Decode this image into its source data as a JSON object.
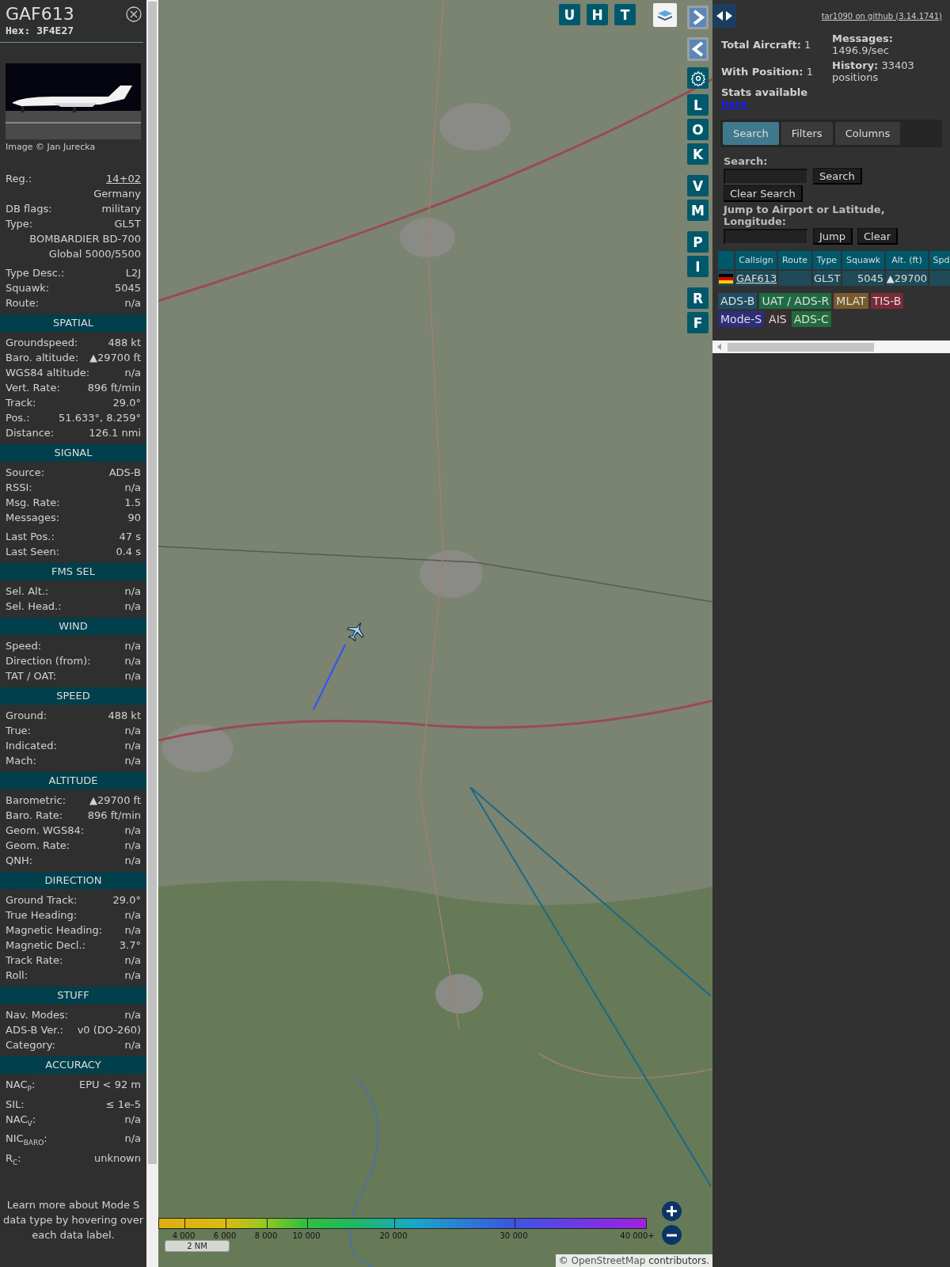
{
  "details": {
    "callsign": "GAF613",
    "hex": "Hex: 3F4E27",
    "photo_credit": "Image © Jan Jurecka",
    "registration": {
      "label": "Reg.:",
      "value": "14+02"
    },
    "groups": [
      [
        {
          "value": "Germany"
        },
        {
          "label": "DB flags:",
          "value": "military"
        },
        {
          "label": "Type:",
          "value": "GL5T"
        },
        {
          "value": "BOMBARDIER BD-700\nGlobal 5000/5500"
        }
      ],
      [
        {
          "label": "Type Desc.:",
          "value": "L2J"
        },
        {
          "label": "Squawk:",
          "value": "5045"
        },
        {
          "label": "Route:",
          "value": "n/a"
        }
      ]
    ],
    "sections": [
      {
        "title": "SPATIAL",
        "groups": [
          [
            {
              "label": "Groundspeed:",
              "value": "488 kt"
            },
            {
              "label": "Baro. altitude:",
              "value": "▲29700 ft"
            },
            {
              "label": "WGS84 altitude:",
              "value": "n/a"
            },
            {
              "label": "Vert. Rate:",
              "value": "896 ft/min"
            },
            {
              "label": "Track:",
              "value": "29.0°"
            },
            {
              "label": "Pos.:",
              "value": "51.633°, 8.259°"
            },
            {
              "label": "Distance:",
              "value": "126.1 nmi"
            }
          ]
        ]
      },
      {
        "title": "SIGNAL",
        "groups": [
          [
            {
              "label": "Source:",
              "value": "ADS-B"
            },
            {
              "label": "RSSI:",
              "value": "n/a"
            },
            {
              "label": "Msg. Rate:",
              "value": "1.5"
            },
            {
              "label": "Messages:",
              "value": "90"
            }
          ],
          [
            {
              "label": "Last Pos.:",
              "value": "47 s"
            },
            {
              "label": "Last Seen:",
              "value": "0.4 s"
            }
          ]
        ]
      },
      {
        "title": "FMS SEL",
        "groups": [
          [
            {
              "label": "Sel. Alt.:",
              "value": "n/a"
            },
            {
              "label": "Sel. Head.:",
              "value": "n/a"
            }
          ]
        ]
      },
      {
        "title": "WIND",
        "groups": [
          [
            {
              "label": "Speed:",
              "value": "n/a"
            },
            {
              "label": "Direction (from):",
              "value": "n/a"
            },
            {
              "label": "TAT / OAT:",
              "value": "n/a"
            }
          ]
        ]
      },
      {
        "title": "SPEED",
        "groups": [
          [
            {
              "label": "Ground:",
              "value": "488 kt"
            },
            {
              "label": "True:",
              "value": "n/a"
            },
            {
              "label": "Indicated:",
              "value": "n/a"
            },
            {
              "label": "Mach:",
              "value": "n/a"
            }
          ]
        ]
      },
      {
        "title": "ALTITUDE",
        "groups": [
          [
            {
              "label": "Barometric:",
              "value": "▲29700 ft"
            },
            {
              "label": "Baro. Rate:",
              "value": "896 ft/min"
            },
            {
              "label": "Geom. WGS84:",
              "value": "n/a"
            },
            {
              "label": "Geom. Rate:",
              "value": "n/a"
            },
            {
              "label": "QNH:",
              "value": "n/a"
            }
          ]
        ]
      },
      {
        "title": "DIRECTION",
        "groups": [
          [
            {
              "label": "Ground Track:",
              "value": "29.0°"
            },
            {
              "label": "True Heading:",
              "value": "n/a"
            },
            {
              "label": "Magnetic Heading:",
              "value": "n/a"
            },
            {
              "label": "Magnetic Decl.:",
              "value": "3.7°"
            },
            {
              "label": "Track Rate:",
              "value": "n/a"
            },
            {
              "label": "Roll:",
              "value": "n/a"
            }
          ]
        ]
      },
      {
        "title": "STUFF",
        "groups": [
          [
            {
              "label": "Nav. Modes:",
              "value": "n/a"
            },
            {
              "label": "ADS-B Ver.:",
              "value": "v0 (DO-260)"
            },
            {
              "label": "Category:",
              "value": "n/a"
            }
          ]
        ]
      },
      {
        "title": "ACCURACY",
        "groups": [
          [
            {
              "label": "NAC$_{P}$:",
              "value": "EPU < 92 m"
            },
            {
              "label": "SIL:",
              "value": "≤ 1e-5"
            },
            {
              "label": "NAC$_{V}$:",
              "value": "n/a"
            },
            {
              "label": "NIC$_{BARO}$:",
              "value": "n/a"
            },
            {
              "label": "R$_{C}$:",
              "value": "unknown"
            }
          ]
        ]
      }
    ],
    "note": "Learn more about Mode S data type by hovering over each data label."
  },
  "map": {
    "top_buttons": [
      "U",
      "H",
      "T"
    ],
    "side_buttons": [
      {
        "kind": "next"
      },
      {
        "kind": "prev"
      },
      {
        "kind": "settings"
      },
      {
        "kind": "letter",
        "label": "L"
      },
      {
        "kind": "letter",
        "label": "O"
      },
      {
        "kind": "letter",
        "label": "K"
      },
      {
        "kind": "letter",
        "label": "V"
      },
      {
        "kind": "letter",
        "label": "M"
      },
      {
        "kind": "letter",
        "label": "P"
      },
      {
        "kind": "letter",
        "label": "I"
      },
      {
        "kind": "letter",
        "label": "R"
      },
      {
        "kind": "letter",
        "label": "F"
      }
    ],
    "altitude_legend": [
      "4 000",
      "6 000",
      "8 000",
      "10 000",
      "20 000",
      "30 000",
      "40 000+"
    ],
    "scale": "2 NM",
    "attribution": {
      "prefix": "©",
      "link": "OpenStreetMap",
      "suffix": "contributors."
    }
  },
  "sidebar": {
    "version_link": "tar1090 on github (3.14.1741)",
    "stats_left": [
      {
        "label": "Total Aircraft:",
        "value": "1"
      },
      {
        "label": "With Position:",
        "value": "1"
      }
    ],
    "stats_link": {
      "label": "Stats available",
      "link": "here"
    },
    "stats_right": [
      {
        "label": "Messages:",
        "value": "1496.9/sec"
      },
      {
        "label": "History:",
        "value": "33403 positions"
      }
    ],
    "tabs": [
      {
        "label": "Search",
        "selected": true
      },
      {
        "label": "Filters",
        "selected": false
      },
      {
        "label": "Columns",
        "selected": false
      }
    ],
    "search": {
      "label": "Search:",
      "button": "Search",
      "clear_button": "Clear Search",
      "jump_label": "Jump to Airport or Latitude, Longitude:",
      "jump_button": "Jump",
      "jump_clear": "Clear"
    },
    "table": {
      "columns": [
        "Callsign",
        "Route",
        "Type",
        "Squawk",
        "Alt. (ft)",
        "Spd"
      ],
      "rows": [
        {
          "callsign": "GAF613",
          "type": "GL5T",
          "squawk": "5045",
          "altitude": "▲29700"
        }
      ]
    },
    "sources": [
      {
        "label": "ADS-B",
        "color": "#1e4d63"
      },
      {
        "label": "UAT / ADS-R",
        "color": "#1f6b44"
      },
      {
        "label": "MLAT",
        "color": "#7a5a2c"
      },
      {
        "label": "TIS-B",
        "color": "#7a2a38"
      },
      {
        "label": "Mode-S",
        "color": "#2e2d7a"
      },
      {
        "label": "AIS",
        "color": "#3a2e2e"
      },
      {
        "label": "ADS-C",
        "color": "#236b3c"
      }
    ]
  }
}
